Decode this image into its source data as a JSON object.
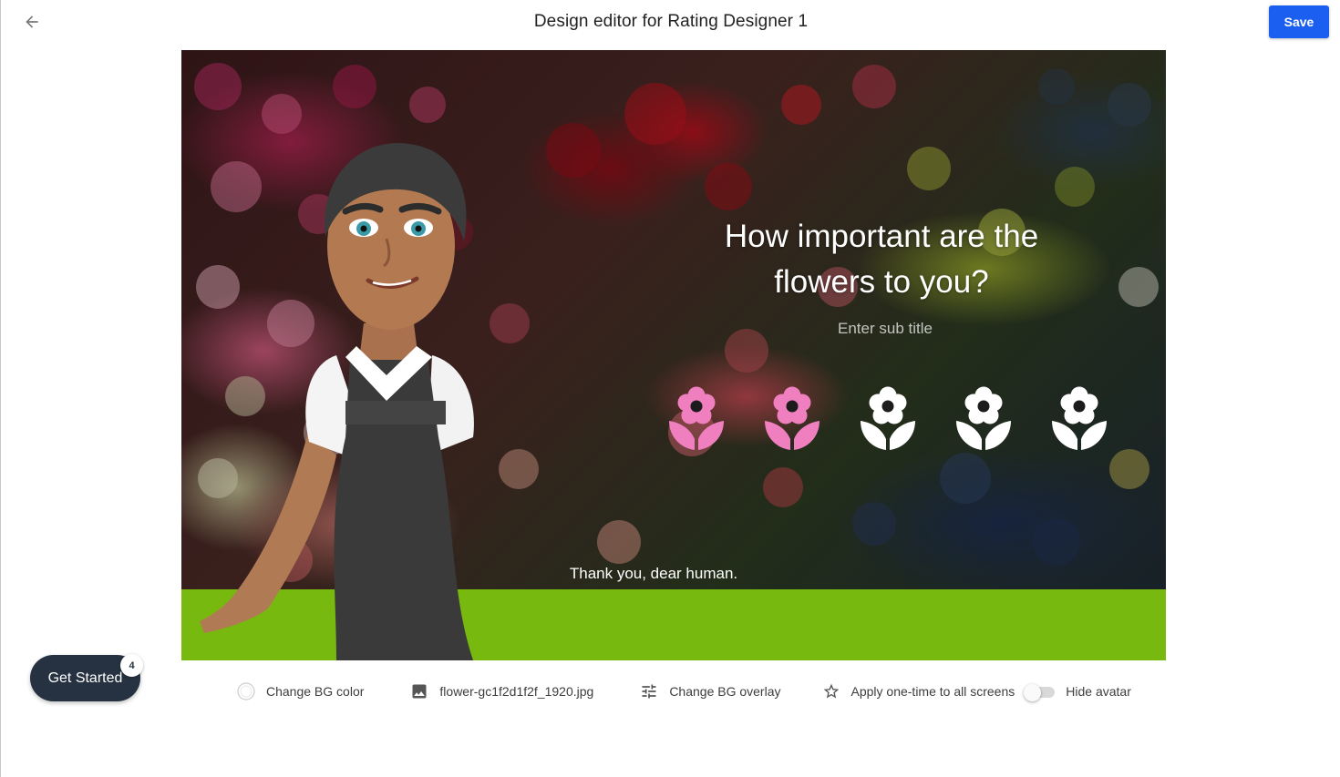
{
  "header": {
    "title": "Design editor for Rating Designer 1",
    "save_label": "Save"
  },
  "screen": {
    "question": "How important are the flowers to you?",
    "subtitle_placeholder": "Enter sub title",
    "footer_text": "Thank you, dear human.",
    "footer_color": "#77b90e",
    "rating": {
      "icon": "flower-icon",
      "scale_max": 5,
      "selected": 2,
      "active_color": "#f07fbf",
      "inactive_color": "#ffffff"
    }
  },
  "toolbar": {
    "bg_color_label": "Change BG color",
    "bg_image_name": "flower-gc1f2d1f2f_1920.jpg",
    "bg_overlay_label": "Change BG overlay",
    "apply_all_label": "Apply one-time to all screens",
    "hide_avatar_label": "Hide avatar",
    "hide_avatar_on": false
  },
  "get_started": {
    "label": "Get Started",
    "badge": "4"
  },
  "colors": {
    "primary": "#1a5ff0",
    "dark": "#263241"
  }
}
